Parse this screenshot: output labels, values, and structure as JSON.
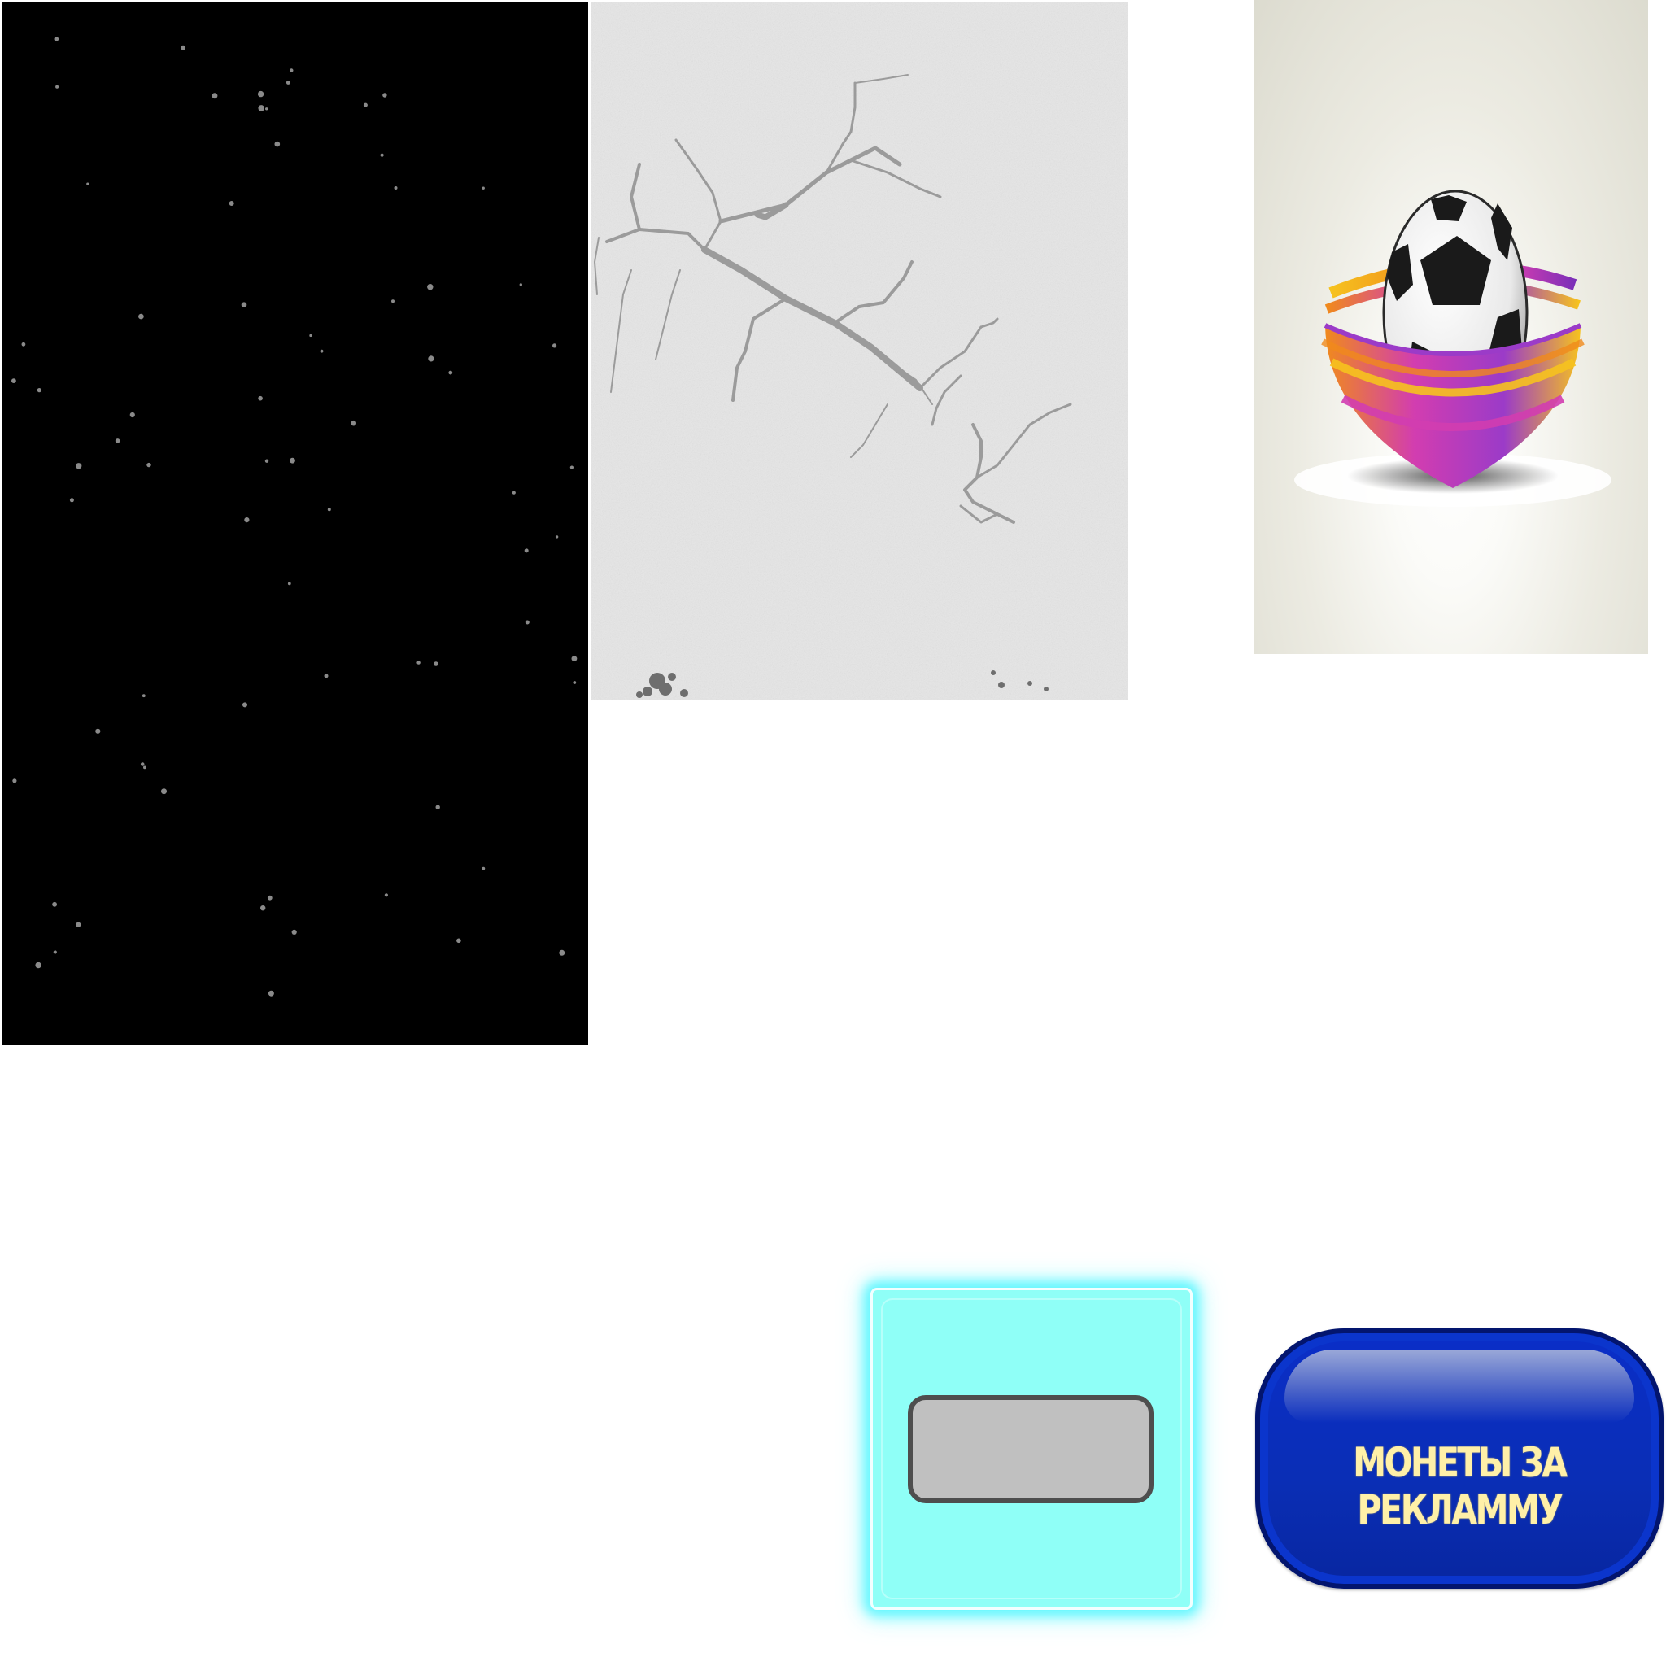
{
  "sprites": {
    "starfield": {
      "background": "#000000",
      "star_color": "#8a8a8a"
    },
    "concrete": {
      "background": "#e4e4e4",
      "crack_color": "#9b9b9b"
    },
    "soccer_logo": {
      "ribbon_colors": [
        "#f08a1c",
        "#d23db0",
        "#9b3bc8",
        "#f6c21e"
      ]
    },
    "cyan_tile": {
      "fill": "#8ffff7",
      "glow": "#63f7ff",
      "slot_fill": "#c0c0c0",
      "slot_border": "#4e4e4e"
    },
    "ads_button": {
      "label": "МОНЕТЫ ЗА РЕКЛАММУ",
      "fill": "#0a2ec8",
      "text_color": "#fff0a8"
    }
  }
}
